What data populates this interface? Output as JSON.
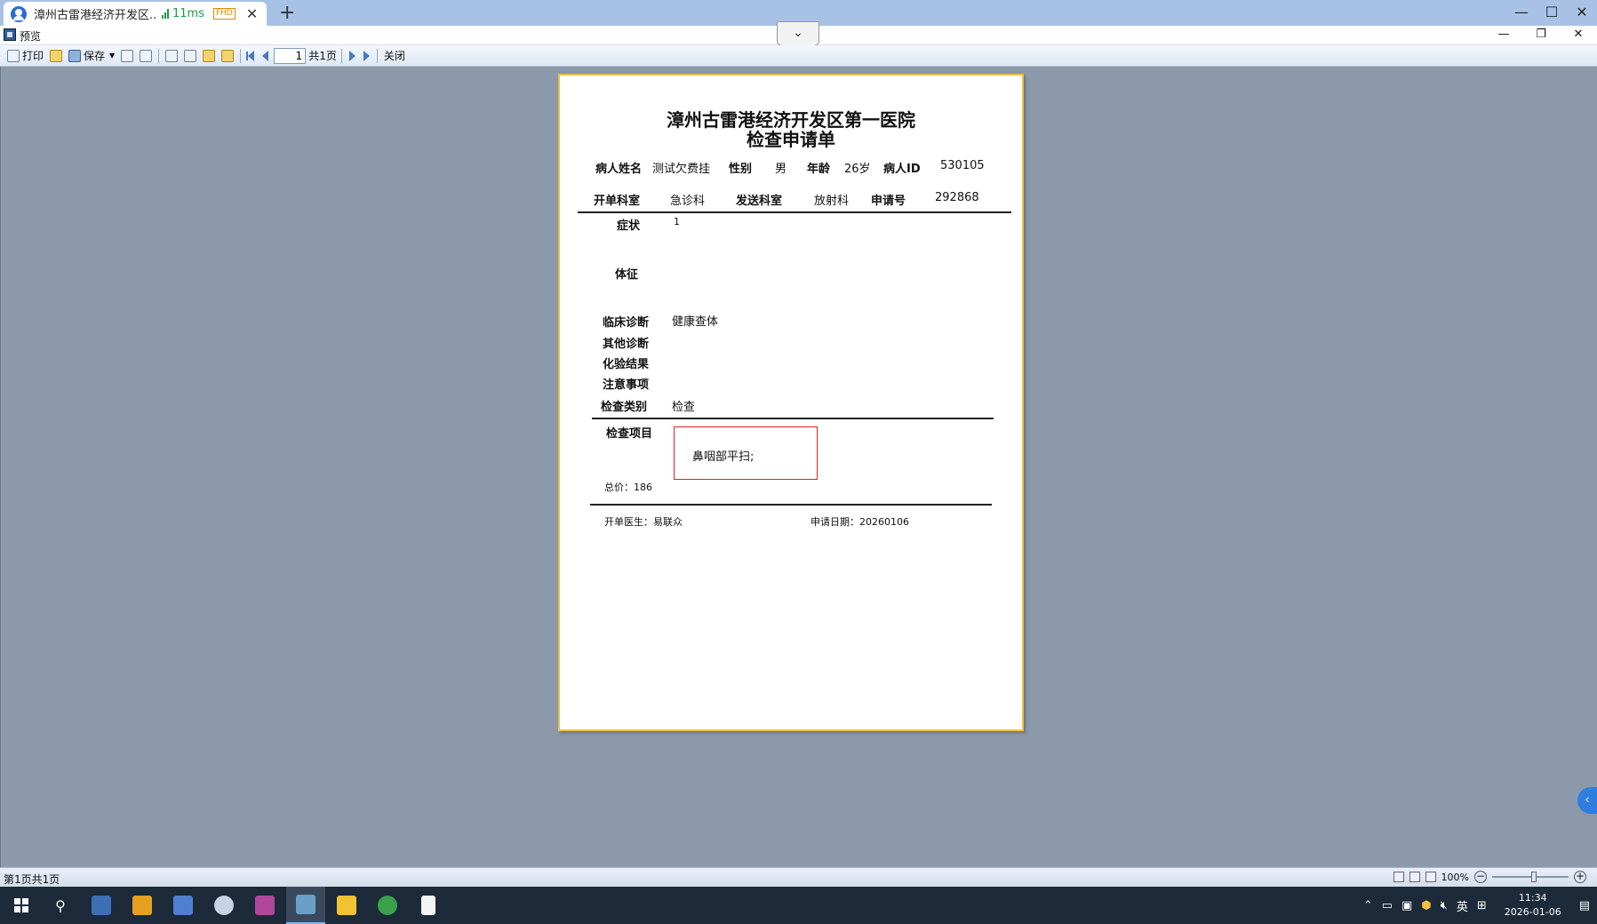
{
  "browser": {
    "tab_title": "漳州古雷港经济开发区...",
    "latency": "11ms",
    "badge": "FHD",
    "new_tab": "+"
  },
  "window": {
    "title": "预览"
  },
  "toolbar": {
    "print_label": "打印",
    "save_label": "保存",
    "page_value": "1",
    "page_total": "共1页",
    "close_label": "关闭"
  },
  "report": {
    "hospital": "漳州古雷港经济开发区第一医院",
    "form_title": "检查申请单",
    "labels": {
      "patient_name": "病人姓名",
      "gender": "性别",
      "age": "年龄",
      "patient_id": "病人ID",
      "ordering_dept": "开单科室",
      "sending_dept": "发送科室",
      "request_no": "申请号",
      "symptoms": "症状",
      "signs": "体征",
      "clinical_dx": "临床诊断",
      "other_dx": "其他诊断",
      "lab_results": "化验结果",
      "notes": "注意事项",
      "exam_category": "检查类别",
      "exam_items": "检查项目"
    },
    "values": {
      "patient_name": "测试欠费挂",
      "gender": "男",
      "age": "26岁",
      "patient_id": "530105",
      "ordering_dept": "急诊科",
      "sending_dept": "放射科",
      "request_no": "292868",
      "symptoms": "1",
      "clinical_dx": "健康查体",
      "exam_category": "检查",
      "exam_item": "鼻咽部平扫;",
      "total_price": "总价：186",
      "doctor": "开单医生：易联众",
      "request_date": "申请日期：20260106"
    }
  },
  "statusbar": {
    "page_status": "第1页共1页",
    "zoom": "100%"
  },
  "taskbar": {
    "ime": "英",
    "time": "11:34",
    "date": "2026-01-06"
  },
  "colors": {
    "canvas": "#8b99aa",
    "paper_border": "#f0c040",
    "item_box": "#e02020",
    "taskbar": "#1c2a3a",
    "tabbar": "#a8c2e6"
  }
}
